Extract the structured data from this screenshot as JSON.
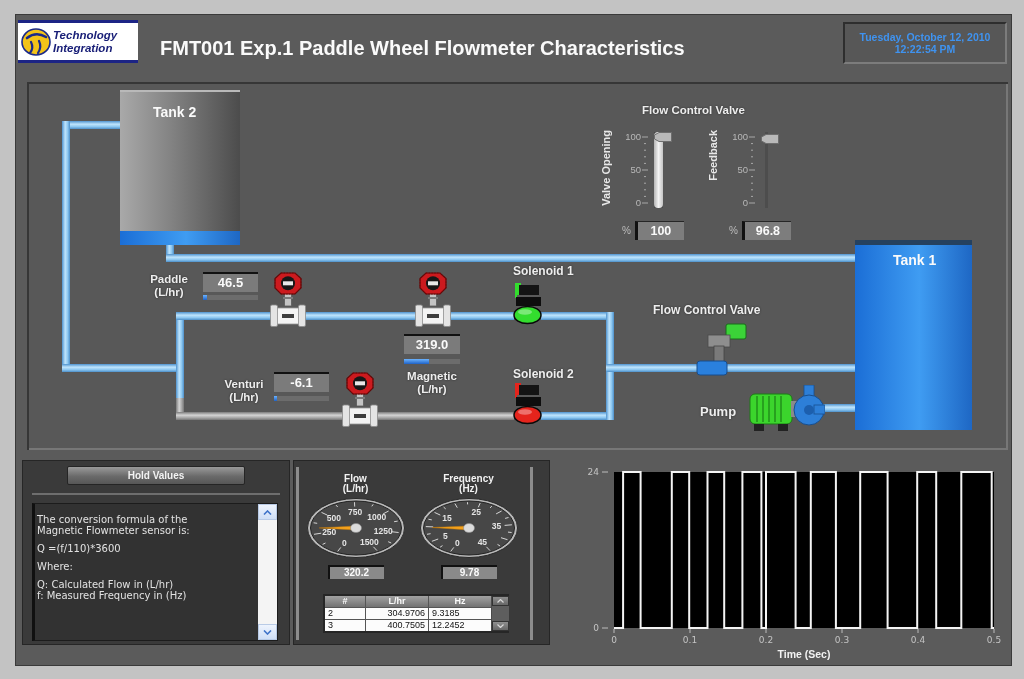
{
  "header": {
    "logo": {
      "lines": [
        "Technology",
        "Integration"
      ]
    },
    "title": "FMT001 Exp.1 Paddle Wheel Flowmeter Characteristics",
    "date": "Tuesday, October 12, 2010",
    "time": "12:22:54 PM"
  },
  "process": {
    "tanks": [
      {
        "label": "Tank 2",
        "level": 0.09
      },
      {
        "label": "Tank 1",
        "level": 1
      }
    ],
    "valve_panel": {
      "title": "Flow Control Valve",
      "sliders": [
        {
          "kind": "control",
          "label": "Valve Opening",
          "scale": [
            "100",
            "50",
            "0"
          ],
          "level": 1,
          "unit": "%",
          "value": "100"
        },
        {
          "kind": "indicator",
          "label": "Feedback",
          "scale": [
            "100",
            "50",
            "0"
          ],
          "level": 0.968,
          "unit": "%",
          "value": "96.8"
        }
      ]
    },
    "flowmeters": [
      {
        "label_lines": [
          "Paddle",
          "(L/hr)"
        ],
        "value": "46.5",
        "level": 0.08
      },
      {
        "label_lines": [
          "Magnetic",
          "(L/hr)"
        ],
        "value": "319.0",
        "level": 0.45
      },
      {
        "label_lines": [
          "Venturi",
          "(L/hr)"
        ],
        "value": "-6.1",
        "level": 0.05
      }
    ],
    "solenoids": [
      {
        "label": "Solenoid 1",
        "open": true
      },
      {
        "label": "Solenoid 2",
        "open": false
      }
    ],
    "control_valve": {
      "label": "Flow Control Valve"
    },
    "pump": {
      "label": "Pump"
    }
  },
  "hold_button": {
    "label": "Hold Values"
  },
  "notes": {
    "paragraphs": [
      [
        "The conversion formula of the Magnetic Flowmeter sensor is:"
      ],
      [
        "Q =(f/110)*3600"
      ],
      [
        "Where:"
      ],
      [
        "Q: Calculated Flow in (L/hr)",
        "f: Measured Frequency in (Hz)"
      ]
    ]
  },
  "gauges": [
    {
      "title_lines": [
        "Flow",
        "(L/hr)"
      ],
      "scale": [
        "0",
        "250",
        "500",
        "750",
        "1000",
        "1250",
        "1500"
      ],
      "level": 0.213,
      "value": "320.2"
    },
    {
      "title_lines": [
        "Frequency",
        "(Hz)"
      ],
      "scale": [
        "0",
        "5",
        "15",
        "25",
        "35",
        "45"
      ],
      "level": 0.217,
      "value": "9.78"
    }
  ],
  "table": {
    "columns": [
      "#",
      "L/hr",
      "Hz"
    ],
    "rows": [
      [
        "2",
        "304.9706",
        "9.3185"
      ],
      [
        "3",
        "400.7505",
        "12.2452"
      ]
    ]
  },
  "chart": {
    "chart_data": {
      "type": "line",
      "xlabel": "Time (Sec)",
      "xlim": [
        0,
        0.5
      ],
      "ylim": [
        0,
        24
      ],
      "xticks": [
        0,
        0.1,
        0.2,
        0.3,
        0.4,
        0.5
      ],
      "yticks": [
        0,
        24
      ],
      "x": [
        0,
        0.012,
        0.012,
        0.035,
        0.035,
        0.076,
        0.076,
        0.099,
        0.099,
        0.123,
        0.123,
        0.145,
        0.145,
        0.169,
        0.169,
        0.194,
        0.194,
        0.2,
        0.2,
        0.239,
        0.239,
        0.259,
        0.259,
        0.292,
        0.292,
        0.324,
        0.324,
        0.36,
        0.36,
        0.399,
        0.399,
        0.424,
        0.424,
        0.457,
        0.457,
        0.497,
        0.497,
        0.5
      ],
      "values": [
        0,
        0,
        24,
        24,
        0,
        0,
        24,
        24,
        0,
        0,
        24,
        24,
        0,
        0,
        24,
        24,
        0,
        0,
        24,
        24,
        0,
        0,
        24,
        24,
        0,
        0,
        24,
        24,
        0,
        0,
        24,
        24,
        0,
        0,
        24,
        24,
        0,
        0
      ]
    }
  }
}
